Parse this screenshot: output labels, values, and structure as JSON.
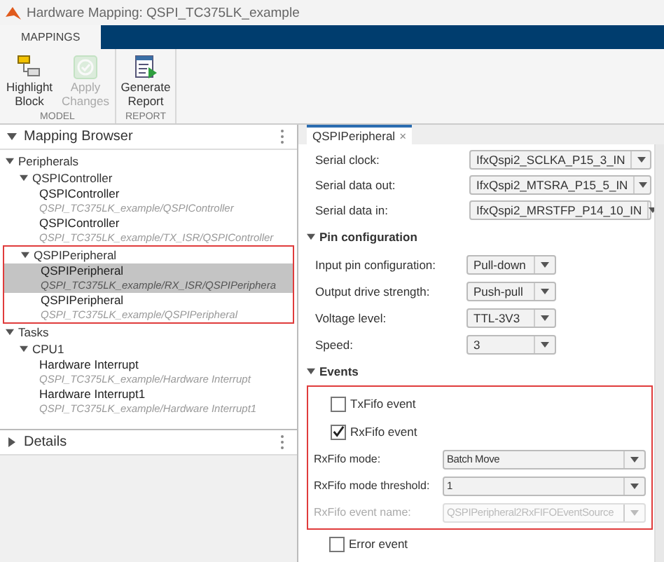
{
  "window": {
    "title": "Hardware Mapping: QSPI_TC375LK_example"
  },
  "ribbon_tabs": [
    {
      "label": "MAPPINGS",
      "selected": true
    }
  ],
  "ribbon_groups": [
    {
      "label": "MODEL",
      "buttons": [
        {
          "label": "Highlight Block",
          "disabled": false
        },
        {
          "label": "Apply Changes",
          "disabled": true
        }
      ]
    },
    {
      "label": "REPORT",
      "buttons": [
        {
          "label": "Generate Report",
          "disabled": false
        }
      ]
    }
  ],
  "mapping_browser": {
    "title": "Mapping Browser",
    "expanded": true,
    "tree": [
      {
        "label": "Peripherals",
        "expanded": true,
        "children": [
          {
            "label": "QSPIController",
            "expanded": true,
            "children": [
              {
                "label": "QSPIController",
                "path": "QSPI_TC375LK_example/QSPIController",
                "selected": false
              },
              {
                "label": "QSPIController",
                "path": "QSPI_TC375LK_example/TX_ISR/QSPIController",
                "selected": false
              }
            ]
          },
          {
            "label": "QSPIPeripheral",
            "expanded": true,
            "highlighted": true,
            "children": [
              {
                "label": "QSPIPeripheral",
                "path": "QSPI_TC375LK_example/RX_ISR/QSPIPeriphera",
                "selected": true
              },
              {
                "label": "QSPIPeripheral",
                "path": "QSPI_TC375LK_example/QSPIPeripheral",
                "selected": false
              }
            ]
          }
        ]
      },
      {
        "label": "Tasks",
        "expanded": true,
        "children": [
          {
            "label": "CPU1",
            "expanded": true,
            "children": [
              {
                "label": "Hardware Interrupt",
                "path": "QSPI_TC375LK_example/Hardware Interrupt",
                "selected": false
              },
              {
                "label": "Hardware Interrupt1",
                "path": "QSPI_TC375LK_example/Hardware Interrupt1",
                "selected": false
              }
            ]
          }
        ]
      }
    ]
  },
  "details": {
    "title": "Details",
    "expanded": false
  },
  "editor_tab": {
    "label": "QSPIPeripheral",
    "close": "×"
  },
  "top_fields": [
    {
      "label": "Serial clock:",
      "value": "IfxQspi2_SCLKA_P15_3_IN",
      "disabled": false
    },
    {
      "label": "Serial data out:",
      "value": "IfxQspi2_MTSRA_P15_5_IN",
      "disabled": false
    },
    {
      "label": "Serial data in:",
      "value": "IfxQspi2_MRSTFP_P14_10_IN",
      "disabled": false
    }
  ],
  "sections": [
    {
      "title": "Pin configuration",
      "expanded": true,
      "groups": [
        {
          "fields": [
            {
              "kind": "dropdown",
              "label": "Input pin configuration:",
              "value": "Pull-down",
              "disabled": false
            },
            {
              "kind": "dropdown",
              "label": "Output drive strength:",
              "value": "Push-pull",
              "disabled": false
            },
            {
              "kind": "dropdown",
              "label": "Voltage level:",
              "value": "TTL-3V3",
              "disabled": false
            },
            {
              "kind": "dropdown",
              "label": "Speed:",
              "value": "3",
              "disabled": false
            }
          ]
        }
      ]
    },
    {
      "title": "Events",
      "expanded": true,
      "groups": [
        {
          "highlighted": true,
          "fields": [
            {
              "kind": "checkbox",
              "label": "TxFifo event",
              "checked": false
            },
            {
              "kind": "checkbox",
              "label": "RxFifo event",
              "checked": true
            },
            {
              "kind": "dropdown",
              "label": "RxFifo mode:",
              "value": "Batch Move",
              "disabled": false
            },
            {
              "kind": "dropdown",
              "label": "RxFifo mode threshold:",
              "value": "1",
              "disabled": false
            },
            {
              "kind": "dropdown",
              "label": "RxFifo event name:",
              "value": "QSPIPeripheral2RxFIFOEventSource",
              "disabled": true
            }
          ]
        },
        {
          "fields": [
            {
              "kind": "checkbox",
              "label": "Error event",
              "checked": false
            }
          ]
        }
      ]
    }
  ]
}
